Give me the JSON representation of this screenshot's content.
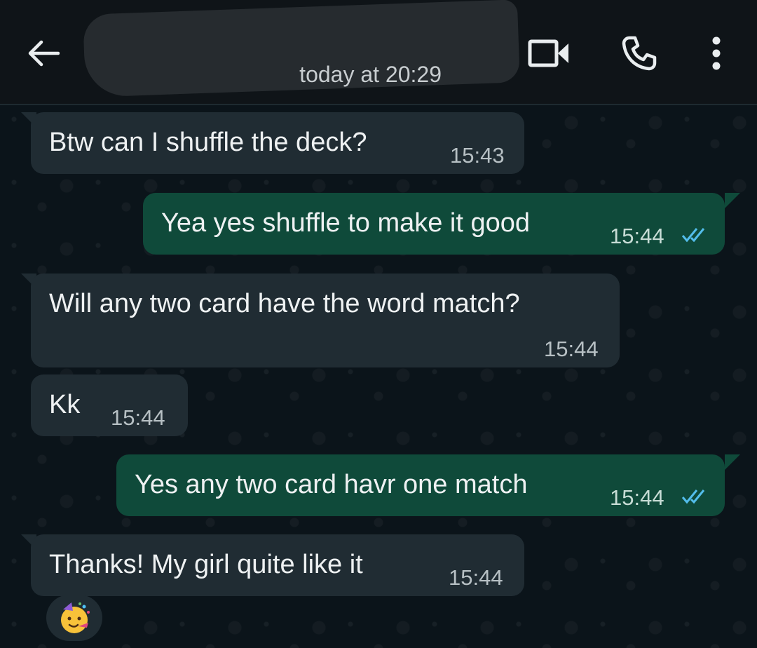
{
  "header": {
    "contact_name": "",
    "last_seen": "today at 20:29",
    "back_icon": "arrow-left-icon",
    "video_icon": "video-call-icon",
    "call_icon": "phone-icon",
    "menu_icon": "more-vertical-icon"
  },
  "messages": [
    {
      "direction": "incoming",
      "text": "Btw can I shuffle the deck?",
      "time": "15:43"
    },
    {
      "direction": "outgoing",
      "text": "Yea yes shuffle to make it good",
      "time": "15:44",
      "status": "read"
    },
    {
      "direction": "incoming",
      "text": "Will any two card have the word match?",
      "time": "15:44"
    },
    {
      "direction": "incoming",
      "text": "Kk",
      "time": "15:44"
    },
    {
      "direction": "outgoing",
      "text": "Yes any two card havr one match",
      "time": "15:44",
      "status": "read"
    },
    {
      "direction": "incoming",
      "text": "Thanks! My girl quite like it",
      "time": "15:44"
    }
  ],
  "reaction": {
    "emoji": "partying-face-icon"
  },
  "colors": {
    "incoming_bubble": "#202c33",
    "outgoing_bubble": "#0f4a3a",
    "read_tick": "#53bdeb",
    "background": "#0b141a"
  }
}
